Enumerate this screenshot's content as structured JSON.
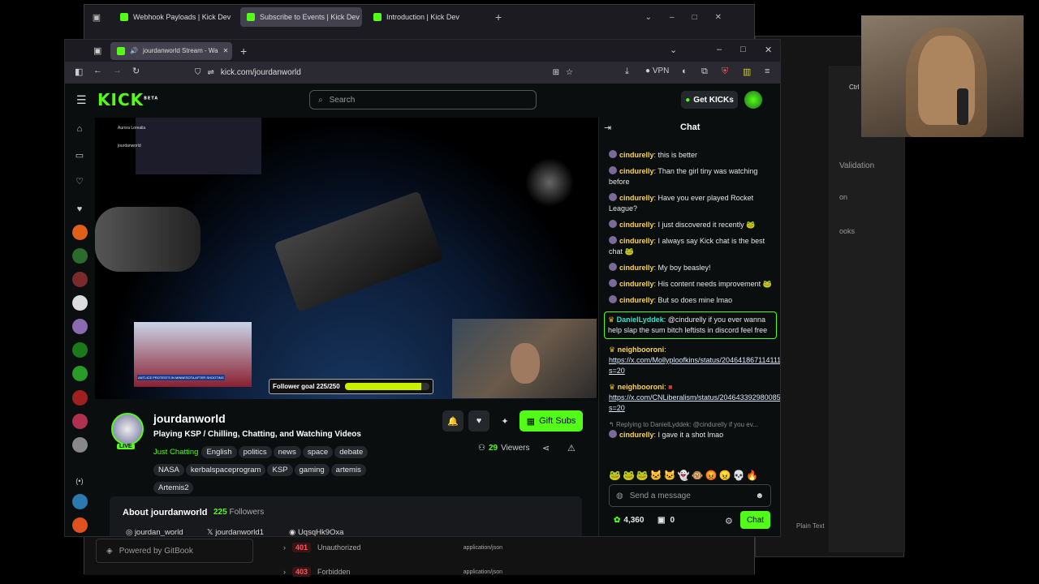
{
  "bg_browser": {
    "tabs": [
      "Webhook Payloads | Kick Dev",
      "Subscribe to Events | Kick Dev",
      "Introduction | Kick Dev"
    ],
    "gitbook": "Powered by GitBook",
    "responses": [
      {
        "code": "401",
        "label": "Unauthorized",
        "type": "application/json"
      },
      {
        "code": "403",
        "label": "Forbidden",
        "type": "application/json"
      }
    ]
  },
  "right_window": {
    "items": [
      "Validation",
      "on",
      "ooks",
      "Plain Text",
      "Ctrl"
    ]
  },
  "window": {
    "tab_title": "jourdanworld Stream - Wa",
    "url": "kick.com/jourdanworld",
    "vpn": "VPN"
  },
  "kick": {
    "logo": "KICK",
    "beta": "BETA",
    "search_placeholder": "Search",
    "get_kicks": "Get KICKs"
  },
  "stream": {
    "follower_goal": "Follower goal 225/250",
    "follower_goal_fraction": 0.9,
    "overlay_names": [
      "Aurora Lorealia",
      "jourdanworld"
    ],
    "news_ticker": "ANTI-ICE PROTESTS IN MINNESOTA AFTER SHOOTING"
  },
  "channel": {
    "name": "jourdanworld",
    "live": "LIVE",
    "title": "Playing KSP / Chilling, Chatting, and Watching Videos",
    "category": "Just Chatting",
    "tags": [
      "English",
      "politics",
      "news",
      "space",
      "debate",
      "NASA",
      "kerbalspaceprogram",
      "KSP",
      "gaming",
      "artemis",
      "Artemis2"
    ],
    "viewers": "29",
    "viewers_label": "Viewers",
    "gift_subs": "Gift Subs",
    "about": "About jourdanworld",
    "followers_count": "225",
    "followers_label": "Followers",
    "socials": [
      "jourdan_world",
      "jourdanworld1",
      "UqsqHk9Oxa"
    ]
  },
  "chat": {
    "title": "Chat",
    "messages": [
      {
        "user": "cindurelly",
        "text": "this is better"
      },
      {
        "user": "cindurelly",
        "text": "Than the girl tiny was watching before"
      },
      {
        "user": "cindurelly",
        "text": "Have you ever played Rocket League?"
      },
      {
        "user": "cindurelly",
        "text": "I just discovered it recently"
      },
      {
        "user": "cindurelly",
        "text": "I always say Kick chat is the best chat"
      },
      {
        "user": "cindurelly",
        "text": "My boy beasley!"
      },
      {
        "user": "cindurelly",
        "text": "His content needs improvement"
      },
      {
        "user": "cindurelly",
        "text": "But so does mine lmao"
      }
    ],
    "highlight": {
      "user": "DanielLyddek",
      "text": "@cindurelly if you ever wanna help slap the sum bitch leftists in discord feel free"
    },
    "link_msgs": [
      {
        "user": "neighbooroni",
        "link": "https://x.com/Mollyploofkins/status/2046418671141114305?s=20"
      },
      {
        "user": "neighbooroni",
        "link": "https://x.com/CNLiberalism/status/2046433929800855977?s=20"
      }
    ],
    "reply_context": "Replying to DanielLyddek: @cindurelly if you ev...",
    "reply": {
      "user": "cindurelly",
      "text": "I gave it a shot lmao"
    },
    "input_placeholder": "Send a message",
    "points": "4,360",
    "drops": "0",
    "send": "Chat"
  }
}
